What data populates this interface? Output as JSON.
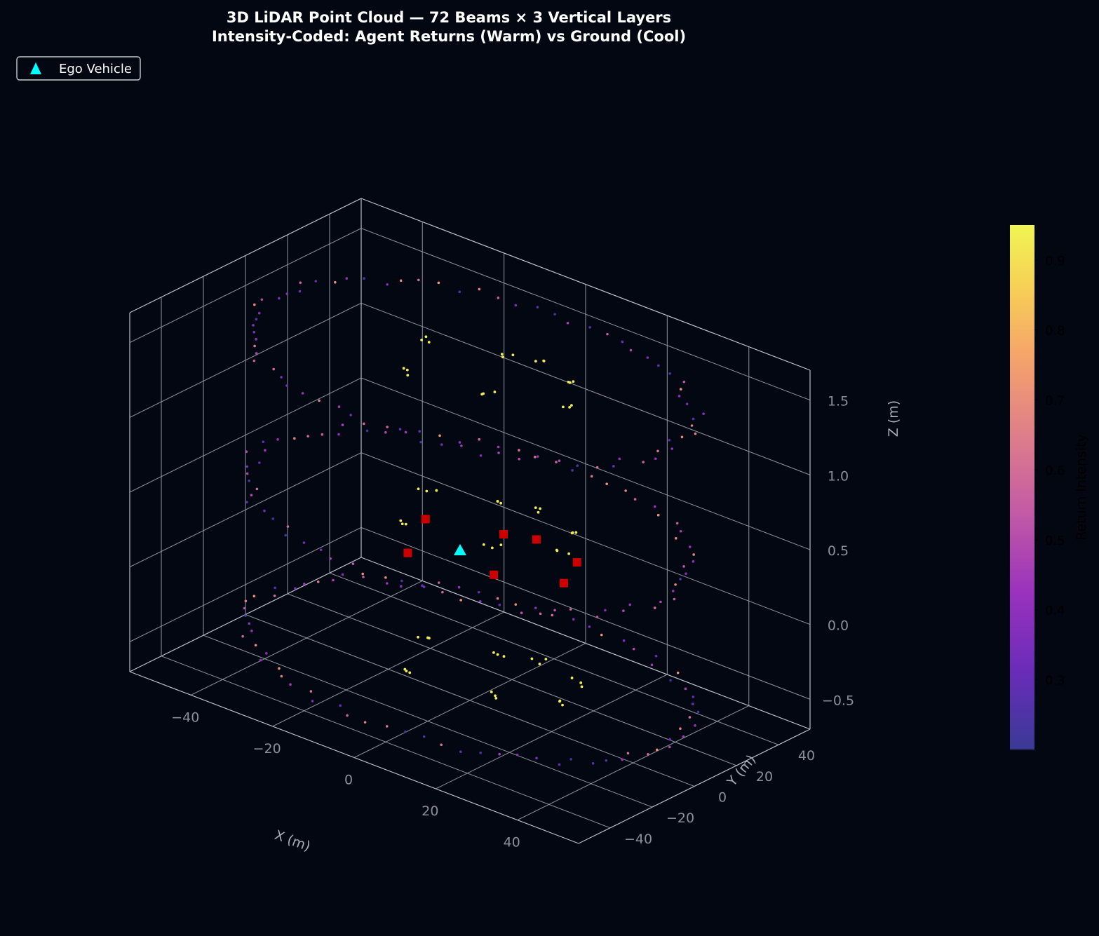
{
  "chart_data": {
    "type": "scatter",
    "title": "3D LiDAR Point Cloud — 72 Beams × 3 Vertical Layers",
    "subtitle": "Intensity-Coded: Agent Returns (Warm) vs Ground (Cool)",
    "xlabel": "X (m)",
    "ylabel": "Y (m)",
    "zlabel": "Z (m)",
    "xlim": [
      -55,
      55
    ],
    "ylim": [
      -55,
      55
    ],
    "zlim": [
      -0.7,
      1.7
    ],
    "x_ticks": [
      "−40",
      "−20",
      "0",
      "20",
      "40"
    ],
    "y_ticks": [
      "−40",
      "−20",
      "0",
      "20",
      "40"
    ],
    "z_ticks": [
      "−0.5",
      "0.0",
      "0.5",
      "1.0",
      "1.5"
    ],
    "x_tick_values": [
      -40,
      -20,
      0,
      20,
      40
    ],
    "y_tick_values": [
      -40,
      -20,
      0,
      20,
      40
    ],
    "z_tick_values": [
      -0.5,
      0,
      0.5,
      1.0,
      1.5
    ],
    "grid": true,
    "legend": {
      "placement": "top-left",
      "entries": [
        {
          "label": "Ego Vehicle",
          "marker": "triangle",
          "color": "#00ffff"
        }
      ]
    },
    "colorbar": {
      "label": "Return Intensity",
      "ticks": [
        "0.3",
        "0.4",
        "0.5",
        "0.6",
        "0.7",
        "0.8",
        "0.9"
      ],
      "tick_values": [
        0.3,
        0.4,
        0.5,
        0.6,
        0.7,
        0.8,
        0.9
      ],
      "range": [
        0.2,
        0.95
      ],
      "colormap": "plasma"
    },
    "ego_vehicle": {
      "x": 0,
      "y": 0,
      "z": 0
    },
    "beams": 72,
    "layers": [
      {
        "z": -0.5,
        "ring_radius": 50
      },
      {
        "z": 0.5,
        "ring_radius": 50
      },
      {
        "z": 1.5,
        "ring_radius": 50
      }
    ],
    "agents": [
      {
        "x": -8,
        "y": -14,
        "z": 0.3
      },
      {
        "x": 10,
        "y": -8,
        "z": 0.3
      },
      {
        "x": 22,
        "y": 2,
        "z": 0.3
      },
      {
        "x": -15,
        "y": 8,
        "z": 0.3
      },
      {
        "x": 6,
        "y": 20,
        "z": 0.3
      },
      {
        "x": 18,
        "y": 16,
        "z": 0.3
      },
      {
        "x": 0,
        "y": 16,
        "z": 0.3
      }
    ],
    "agent_return_intensity": 0.93,
    "agent_marker_color": "#cc0000"
  }
}
